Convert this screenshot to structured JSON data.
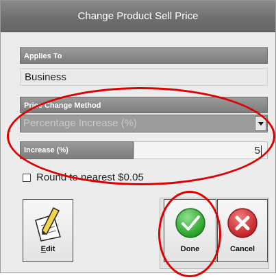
{
  "dialog": {
    "title": "Change Product Sell Price"
  },
  "applies_to": {
    "header": "Applies To",
    "value": "Business"
  },
  "method": {
    "header": "Price Change Method",
    "selected": "Percentage Increase (%)",
    "arrow_icon": "chevron-down-icon"
  },
  "increase": {
    "label": "Increase (%)",
    "value": "5"
  },
  "round": {
    "label": "Round to nearest $0.05",
    "checked": false
  },
  "buttons": {
    "edit": {
      "label_underlined": "E",
      "label_rest": "dit",
      "icon": "pencil-paper-icon"
    },
    "done": {
      "label": "Done",
      "icon": "checkmark-icon",
      "color": "#2fae2f"
    },
    "cancel": {
      "label": "Cancel",
      "icon": "close-x-icon",
      "color": "#d6262b"
    }
  },
  "colors": {
    "annotation": "#e00000",
    "titlebar": "#6e6e6e"
  }
}
